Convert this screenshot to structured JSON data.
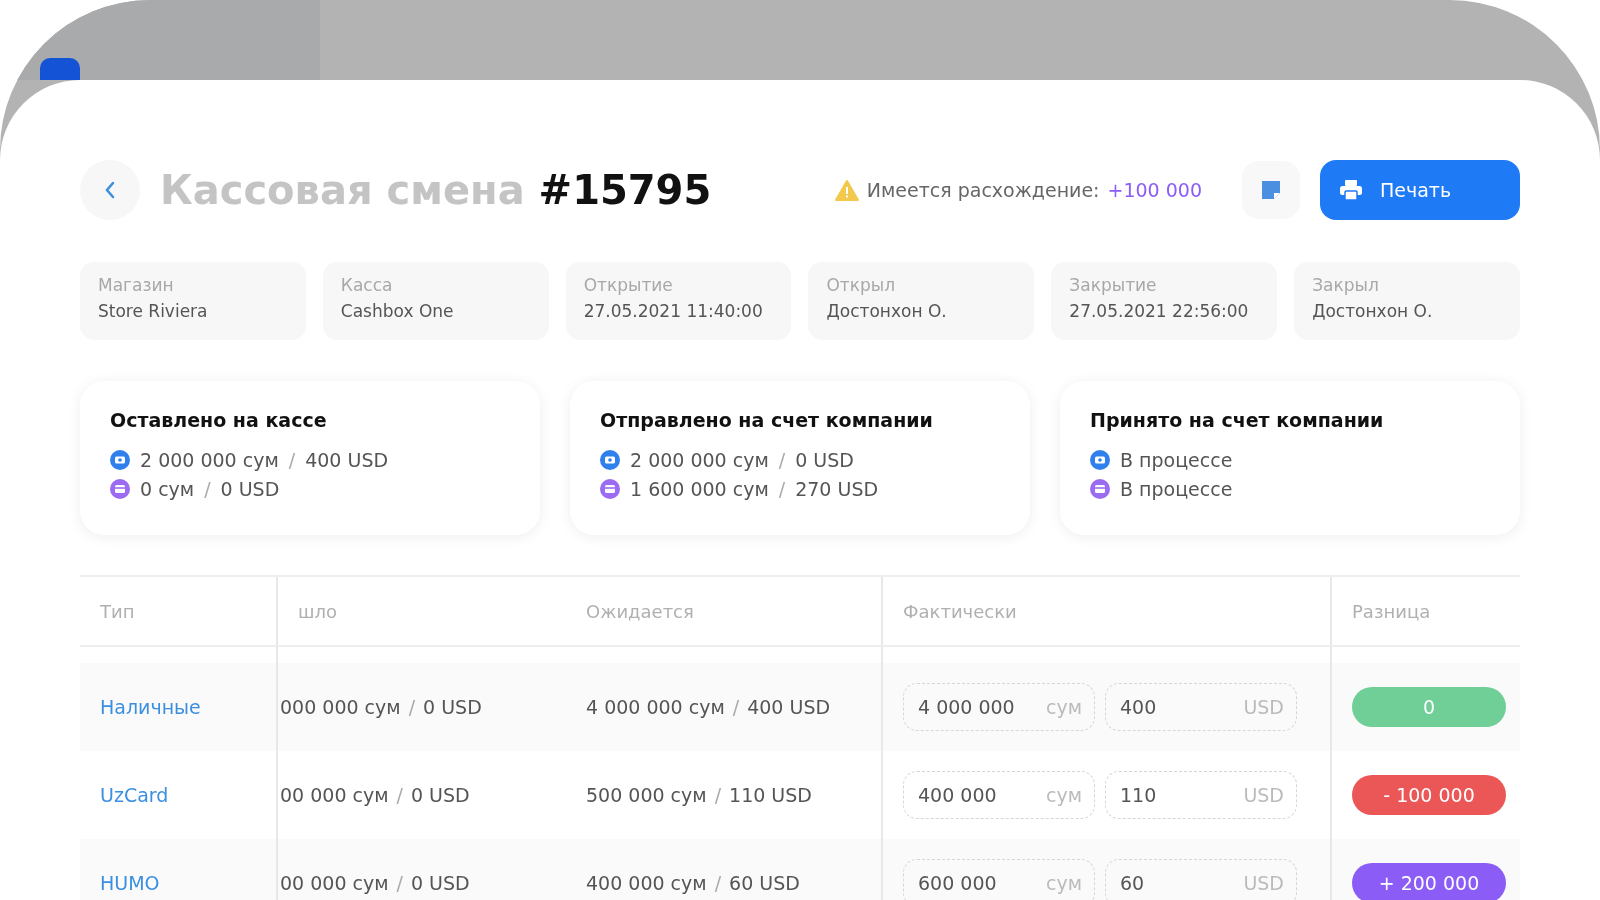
{
  "title": {
    "muted": "Кассовая смена",
    "number": "#15795"
  },
  "discrepancy": {
    "label": "Имеется расхождение:",
    "value": "+100 000"
  },
  "print_button": {
    "label": "Печать"
  },
  "info": [
    {
      "label": "Магазин",
      "value": "Store Riviera"
    },
    {
      "label": "Касса",
      "value": "Cashbox One"
    },
    {
      "label": "Открытие",
      "value": "27.05.2021 11:40:00"
    },
    {
      "label": "Открыл",
      "value": "Достонхон О."
    },
    {
      "label": "Закрытие",
      "value": "27.05.2021 22:56:00"
    },
    {
      "label": "Закрыл",
      "value": "Достонхон О."
    }
  ],
  "separator": "/",
  "summary": [
    {
      "title": "Оставлено на кассе",
      "lines": [
        {
          "kind": "cash",
          "parts": [
            "2 000 000 сум",
            "400 USD"
          ]
        },
        {
          "kind": "card",
          "parts": [
            "0 сум",
            "0 USD"
          ]
        }
      ]
    },
    {
      "title": "Отправлено на счет компании",
      "lines": [
        {
          "kind": "cash",
          "parts": [
            "2 000 000 сум",
            "0 USD"
          ]
        },
        {
          "kind": "card",
          "parts": [
            "1 600 000 сум",
            "270 USD"
          ]
        }
      ]
    },
    {
      "title": "Принято на счет компании",
      "lines": [
        {
          "kind": "cash",
          "parts": [
            "В процессе"
          ]
        },
        {
          "kind": "card",
          "parts": [
            "В процессе"
          ]
        }
      ]
    }
  ],
  "table": {
    "columns": [
      "Тип",
      "шло",
      "Ожидается",
      "Фактически",
      "Разница"
    ],
    "rows": [
      {
        "type": "Наличные",
        "received": [
          "000 000 сум",
          "0 USD"
        ],
        "expected": [
          "4 000 000 сум",
          "400 USD"
        ],
        "actual": [
          {
            "value": "4 000 000",
            "unit": "сум"
          },
          {
            "value": "400",
            "unit": "USD"
          }
        ],
        "difference": "0",
        "color": "#6fcf97"
      },
      {
        "type": "UzCard",
        "received": [
          "00 000 сум",
          "0 USD"
        ],
        "expected": [
          "500 000 сум",
          "110 USD"
        ],
        "actual": [
          {
            "value": "400 000",
            "unit": "сум"
          },
          {
            "value": "110",
            "unit": "USD"
          }
        ],
        "difference": "- 100 000",
        "color": "#eb5757"
      },
      {
        "type": "HUMO",
        "received": [
          "00 000 сум",
          "0 USD"
        ],
        "expected": [
          "400 000 сум",
          "60 USD"
        ],
        "actual": [
          {
            "value": "600 000",
            "unit": "сум"
          },
          {
            "value": "60",
            "unit": "USD"
          }
        ],
        "difference": "+ 200 000",
        "color": "#8b5cf6"
      }
    ]
  }
}
